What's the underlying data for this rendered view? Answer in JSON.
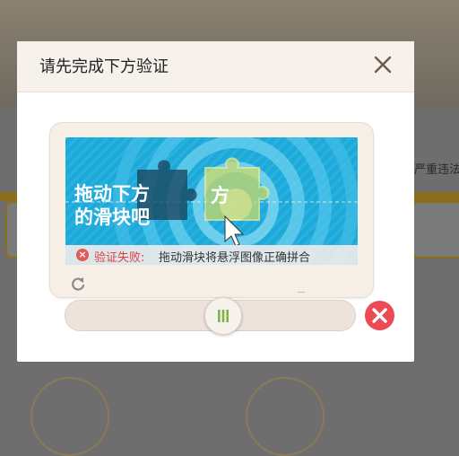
{
  "dialog": {
    "title": "请先完成下方验证"
  },
  "background": {
    "side_text": "严重违法"
  },
  "captcha": {
    "hint_line1": "拖动下方",
    "hint_line2": "的滑块吧",
    "piece_char": "方",
    "status": {
      "label": "验证失败:",
      "message": "拖动滑块将悬浮图像正确拼合"
    }
  },
  "icons": {
    "close": "close-icon",
    "refresh": "refresh-icon",
    "error": "error-icon",
    "grip": "grip-icon",
    "cursor": "cursor-icon"
  },
  "colors": {
    "puzzle_bg": "#1fa9d8",
    "error_red": "#ec4b53",
    "knob_grip": "#7ab648",
    "dialog_header": "#f6f1ea"
  }
}
